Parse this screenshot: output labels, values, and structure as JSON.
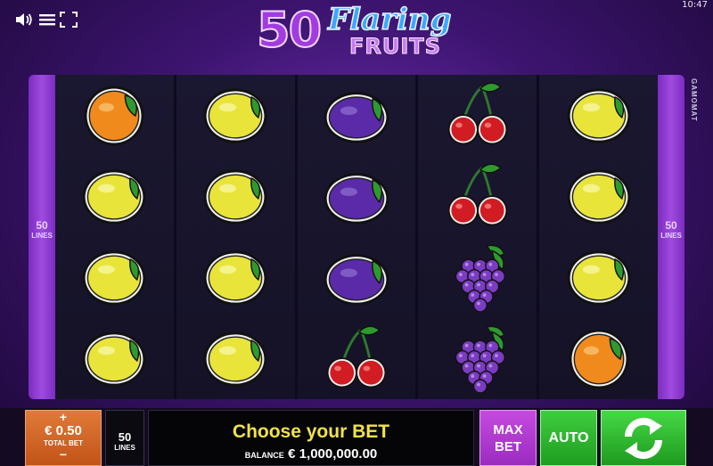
{
  "top": {
    "clock": "10:47",
    "icons": [
      "sound-icon",
      "menu-icon",
      "fullscreen-icon"
    ]
  },
  "logo": {
    "number": "50",
    "word1": "Flaring",
    "word2": "FRUITS"
  },
  "side_label": {
    "lines_count": "50",
    "lines_text": "LINES"
  },
  "provider": "GAMOMAT",
  "reels": [
    [
      "orange",
      "lemon",
      "lemon",
      "lemon"
    ],
    [
      "lemon",
      "lemon",
      "lemon",
      "lemon"
    ],
    [
      "plum",
      "plum",
      "plum",
      "cherry"
    ],
    [
      "cherry",
      "cherry",
      "grapes",
      "grapes"
    ],
    [
      "lemon",
      "lemon",
      "lemon",
      "orange"
    ]
  ],
  "controls": {
    "bet_plus": "+",
    "bet_value": "€ 0.50",
    "bet_caption": "TOTAL BET",
    "bet_minus": "−",
    "lines_value": "50",
    "lines_caption": "LINES",
    "message": "Choose your BET",
    "balance_caption": "BALANCE",
    "balance_value": "€ 1,000,000.00",
    "max_bet_line1": "MAX",
    "max_bet_line2": "BET",
    "auto_label": "AUTO"
  },
  "colors": {
    "accent_purple": "#9a2cbf",
    "spin_green": "#2fb52f",
    "bet_orange": "#d4662a",
    "message_yellow": "#f2e24a"
  }
}
